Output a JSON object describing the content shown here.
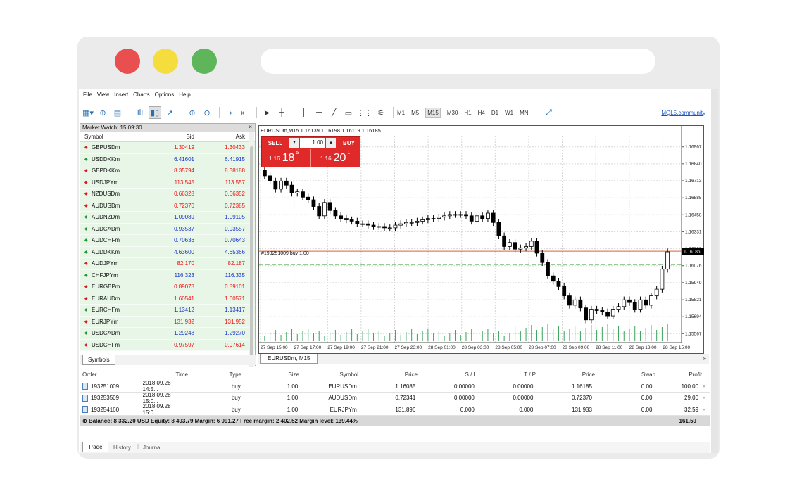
{
  "menu": [
    "File",
    "View",
    "Insert",
    "Charts",
    "Options",
    "Help"
  ],
  "timeframes": [
    "M1",
    "M5",
    "M15",
    "M30",
    "H1",
    "H4",
    "D1",
    "W1",
    "MN"
  ],
  "active_timeframe": "M15",
  "mql_link": "MQL5.community",
  "market_watch": {
    "title": "Market Watch: 15:09:30",
    "close": "×",
    "headers": {
      "symbol": "Symbol",
      "bid": "Bid",
      "ask": "Ask"
    },
    "rows": [
      {
        "symbol": "GBPUSDm",
        "bid": "1.30419",
        "ask": "1.30433",
        "dir": "down",
        "color": "red"
      },
      {
        "symbol": "USDDKKm",
        "bid": "6.41601",
        "ask": "6.41915",
        "dir": "up",
        "color": "blue"
      },
      {
        "symbol": "GBPDKKm",
        "bid": "8.35794",
        "ask": "8.38188",
        "dir": "down",
        "color": "red"
      },
      {
        "symbol": "USDJPYm",
        "bid": "113.545",
        "ask": "113.557",
        "dir": "down",
        "color": "red"
      },
      {
        "symbol": "NZDUSDm",
        "bid": "0.66328",
        "ask": "0.66352",
        "dir": "down",
        "color": "red"
      },
      {
        "symbol": "AUDUSDm",
        "bid": "0.72370",
        "ask": "0.72385",
        "dir": "down",
        "color": "red"
      },
      {
        "symbol": "AUDNZDm",
        "bid": "1.09089",
        "ask": "1.09105",
        "dir": "up",
        "color": "blue"
      },
      {
        "symbol": "AUDCADm",
        "bid": "0.93537",
        "ask": "0.93557",
        "dir": "up",
        "color": "blue"
      },
      {
        "symbol": "AUDCHFm",
        "bid": "0.70636",
        "ask": "0.70643",
        "dir": "up",
        "color": "blue"
      },
      {
        "symbol": "AUDDKKm",
        "bid": "4.63600",
        "ask": "4.65366",
        "dir": "up",
        "color": "blue"
      },
      {
        "symbol": "AUDJPYm",
        "bid": "82.170",
        "ask": "82.187",
        "dir": "down",
        "color": "red"
      },
      {
        "symbol": "CHFJPYm",
        "bid": "116.323",
        "ask": "116.335",
        "dir": "up",
        "color": "blue"
      },
      {
        "symbol": "EURGBPm",
        "bid": "0.89078",
        "ask": "0.89101",
        "dir": "down",
        "color": "red"
      },
      {
        "symbol": "EURAUDm",
        "bid": "1.60541",
        "ask": "1.60571",
        "dir": "down",
        "color": "red"
      },
      {
        "symbol": "EURCHFm",
        "bid": "1.13412",
        "ask": "1.13417",
        "dir": "up",
        "color": "blue"
      },
      {
        "symbol": "EURJPYm",
        "bid": "131.932",
        "ask": "131.952",
        "dir": "down",
        "color": "red"
      },
      {
        "symbol": "USDCADm",
        "bid": "1.29248",
        "ask": "1.29270",
        "dir": "up",
        "color": "blue"
      },
      {
        "symbol": "USDCHFm",
        "bid": "0.97597",
        "ask": "0.97614",
        "dir": "down",
        "color": "red"
      }
    ],
    "tab": "Symbols"
  },
  "chart": {
    "header": "EURUSDm,M15  1.16139 1.16198 1.16119 1.16185",
    "tab": "EURUSDm, M15",
    "scroll_glyph": "»",
    "sell_label": "SELL",
    "buy_label": "BUY",
    "lot": "1.00",
    "sell_price_small": "1.16",
    "sell_price_big": "18",
    "sell_price_sup": "5",
    "buy_price_small": "1.16",
    "buy_price_big": "20",
    "buy_price_sup": "1",
    "order_line_label": "#193251009 buy 1.00",
    "current_price": "1.16185"
  },
  "chart_data": {
    "type": "candlestick",
    "price_labels": [
      "1.16967",
      "1.16840",
      "1.16713",
      "1.16585",
      "1.16458",
      "1.16331",
      "1.16203",
      "1.16076",
      "1.15949",
      "1.15821",
      "1.15694",
      "1.15567"
    ],
    "time_labels": [
      "27 Sep 15:00",
      "27 Sep 17:00",
      "27 Sep 19:00",
      "27 Sep 21:00",
      "27 Sep 23:00",
      "28 Sep 01:00",
      "28 Sep 03:00",
      "28 Sep 05:00",
      "28 Sep 07:00",
      "28 Sep 09:00",
      "28 Sep 11:00",
      "28 Sep 13:00",
      "28 Sep 15:00"
    ],
    "ylim": [
      1.155,
      1.1705
    ],
    "current_price": 1.16185,
    "order_price": 1.16085,
    "closes": [
      1.1675,
      1.1671,
      1.1665,
      1.1671,
      1.1668,
      1.1662,
      1.1663,
      1.1659,
      1.1657,
      1.1652,
      1.1645,
      1.1655,
      1.1649,
      1.1645,
      1.1643,
      1.1642,
      1.1641,
      1.1639,
      1.1639,
      1.1638,
      1.1637,
      1.1637,
      1.1636,
      1.1636,
      1.1638,
      1.1639,
      1.164,
      1.164,
      1.1641,
      1.1642,
      1.1643,
      1.1643,
      1.1644,
      1.1645,
      1.1646,
      1.1646,
      1.1646,
      1.1645,
      1.1641,
      1.1645,
      1.1643,
      1.1647,
      1.164,
      1.163,
      1.1622,
      1.1625,
      1.162,
      1.1621,
      1.1622,
      1.1626,
      1.1617,
      1.161,
      1.16,
      1.1596,
      1.1592,
      1.1585,
      1.1578,
      1.1582,
      1.1576,
      1.1567,
      1.1575,
      1.1574,
      1.1573,
      1.157,
      1.1575,
      1.1577,
      1.1582,
      1.158,
      1.1575,
      1.1582,
      1.1578,
      1.1585,
      1.159,
      1.1605,
      1.1618
    ]
  },
  "trade": {
    "headers": [
      "Order",
      "Time",
      "Type",
      "Size",
      "Symbol",
      "Price",
      "S / L",
      "T / P",
      "Price",
      "Swap",
      "Profit"
    ],
    "rows": [
      [
        "193251009",
        "2018.09.28 14:5...",
        "buy",
        "1.00",
        "EURUSDm",
        "1.16085",
        "0.00000",
        "0.00000",
        "1.16185",
        "0.00",
        "100.00"
      ],
      [
        "193253509",
        "2018.09.28 15:0...",
        "buy",
        "1.00",
        "AUDUSDm",
        "0.72341",
        "0.00000",
        "0.00000",
        "0.72370",
        "0.00",
        "29.00"
      ],
      [
        "193254160",
        "2018.09.28 15:0...",
        "buy",
        "1.00",
        "EURJPYm",
        "131.896",
        "0.000",
        "0.000",
        "131.933",
        "0.00",
        "32.59"
      ]
    ],
    "close_glyph": "×",
    "balance": "Balance: 8 332.20 USD  Equity: 8 493.79  Margin: 6 091.27  Free margin: 2 402.52  Margin level: 139.44%",
    "total": "161.59",
    "tabs": [
      "Trade",
      "History",
      "Journal"
    ]
  }
}
